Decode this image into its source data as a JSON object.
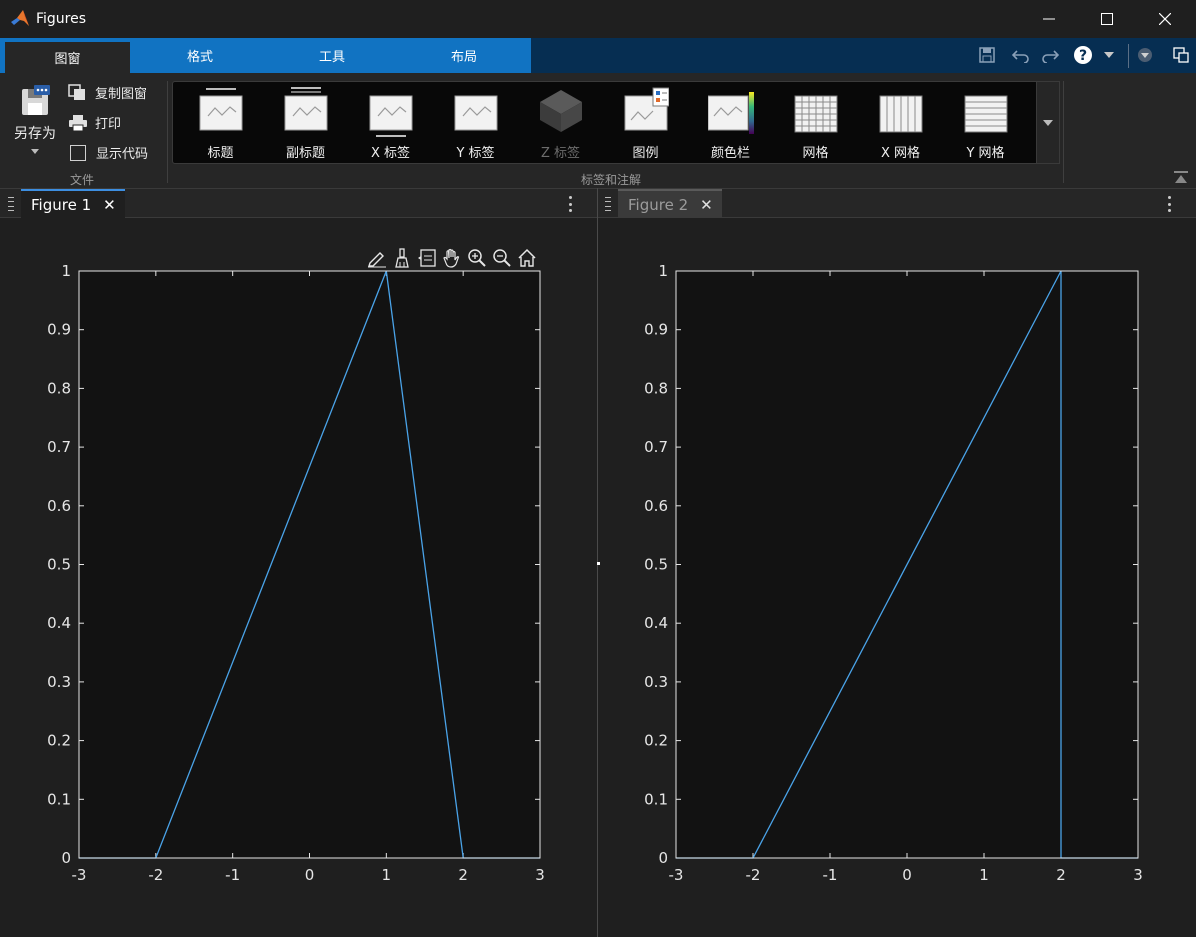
{
  "window": {
    "title": "Figures"
  },
  "ribbon_tabs": [
    {
      "label": "图窗",
      "active": true
    },
    {
      "label": "格式",
      "active": false
    },
    {
      "label": "工具",
      "active": false
    },
    {
      "label": "布局",
      "active": false
    }
  ],
  "file_group": {
    "save_as_label": "另存为",
    "copy_figure_label": "复制图窗",
    "print_label": "打印",
    "show_code_label": "显示代码",
    "show_code_checked": false,
    "group_label": "文件"
  },
  "annotation_group": {
    "group_label": "标签和注解",
    "items": [
      {
        "label": "标题",
        "icon": "title-icon",
        "enabled": true
      },
      {
        "label": "副标题",
        "icon": "subtitle-icon",
        "enabled": true
      },
      {
        "label": "X 标签",
        "icon": "xlabel-icon",
        "enabled": true
      },
      {
        "label": "Y 标签",
        "icon": "ylabel-icon",
        "enabled": true
      },
      {
        "label": "Z 标签",
        "icon": "zlabel-icon",
        "enabled": false
      },
      {
        "label": "图例",
        "icon": "legend-icon",
        "enabled": true
      },
      {
        "label": "颜色栏",
        "icon": "colorbar-icon",
        "enabled": true
      },
      {
        "label": "网格",
        "icon": "grid-icon",
        "enabled": true
      },
      {
        "label": "X 网格",
        "icon": "xgrid-icon",
        "enabled": true
      },
      {
        "label": "Y 网格",
        "icon": "ygrid-icon",
        "enabled": true
      }
    ]
  },
  "figure_tabs": [
    {
      "label": "Figure 1",
      "active": true,
      "close": "✕"
    },
    {
      "label": "Figure 2",
      "active": false,
      "close": "✕"
    }
  ],
  "axes_toolbar": [
    "brush-edit-icon",
    "data-brush-icon",
    "data-tips-icon",
    "pan-hand-icon",
    "zoom-in-icon",
    "zoom-out-icon",
    "home-icon"
  ],
  "colors": {
    "accent": "#1173c2",
    "tab_bar": "#062e52",
    "line": "#4aa3e8",
    "axes_bg": "#121212",
    "figure_bg": "#1f1f1f"
  },
  "chart_data": [
    {
      "type": "line",
      "title": "",
      "xlabel": "",
      "ylabel": "",
      "xlim": [
        -3,
        3
      ],
      "ylim": [
        0,
        1
      ],
      "xticks": [
        "-3",
        "-2",
        "-1",
        "0",
        "1",
        "2",
        "3"
      ],
      "yticks": [
        "0",
        "0.1",
        "0.2",
        "0.3",
        "0.4",
        "0.5",
        "0.6",
        "0.7",
        "0.8",
        "0.9",
        "1"
      ],
      "grid": false,
      "series": [
        {
          "x": [
            -3,
            -2,
            1,
            2,
            3
          ],
          "y": [
            0,
            0,
            1,
            0,
            0
          ]
        }
      ]
    },
    {
      "type": "line",
      "title": "",
      "xlabel": "",
      "ylabel": "",
      "xlim": [
        -3,
        3
      ],
      "ylim": [
        0,
        1
      ],
      "xticks": [
        "-3",
        "-2",
        "-1",
        "0",
        "1",
        "2",
        "3"
      ],
      "yticks": [
        "0",
        "0.1",
        "0.2",
        "0.3",
        "0.4",
        "0.5",
        "0.6",
        "0.7",
        "0.8",
        "0.9",
        "1"
      ],
      "grid": false,
      "series": [
        {
          "x": [
            -3,
            -2,
            2,
            2,
            3
          ],
          "y": [
            0,
            0,
            1,
            0,
            0
          ]
        }
      ]
    }
  ]
}
